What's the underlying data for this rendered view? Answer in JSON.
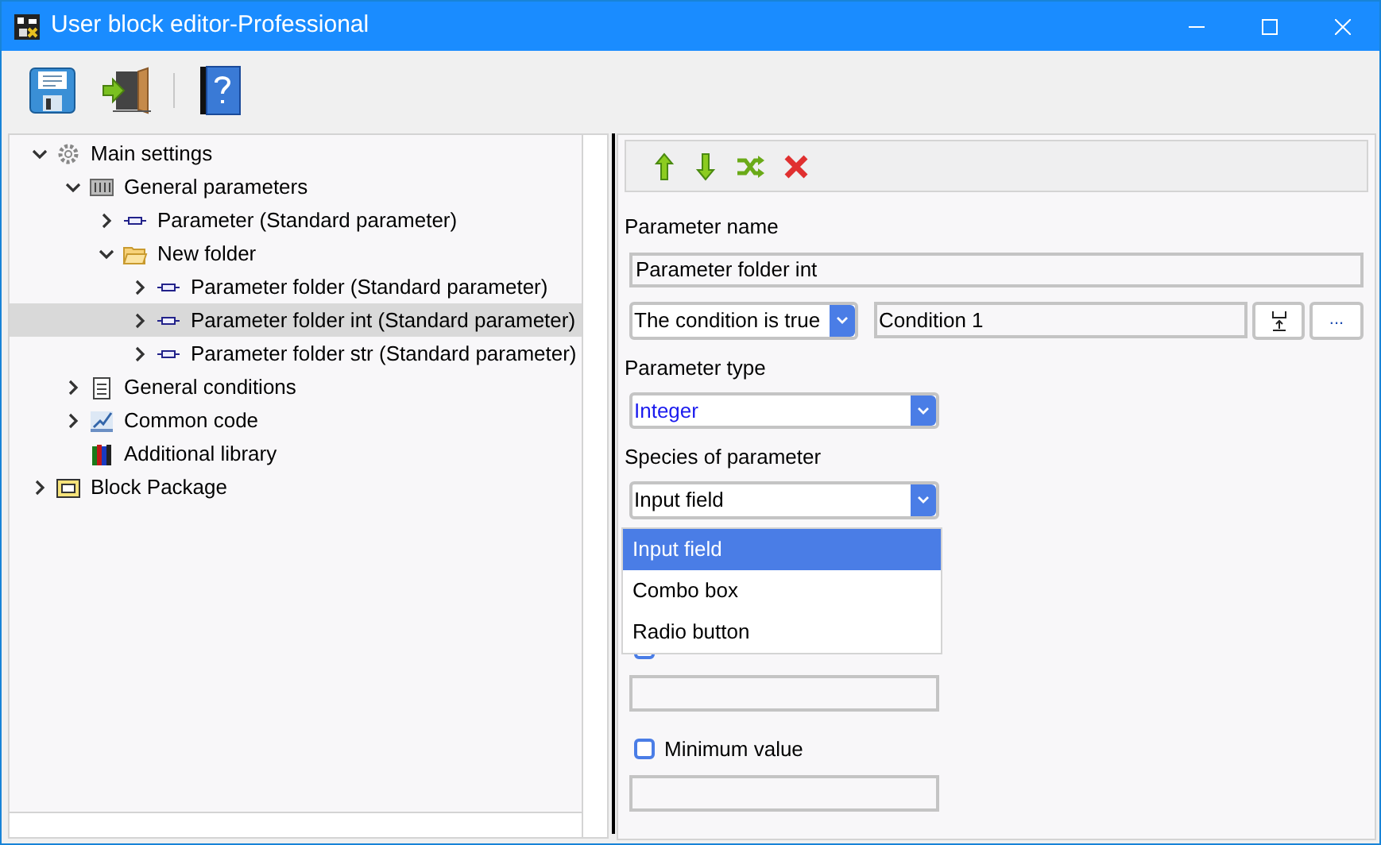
{
  "window": {
    "title": "User block editor-Professional"
  },
  "tree": [
    {
      "label": "Main settings",
      "kind": "settings",
      "expanded": true,
      "selected": false,
      "children": [
        {
          "label": "General parameters",
          "kind": "parameters",
          "expanded": true,
          "selected": false,
          "children": [
            {
              "label": "Parameter (Standard parameter)",
              "kind": "parameter",
              "expanded": false,
              "selected": false
            },
            {
              "label": "New folder",
              "kind": "folder",
              "expanded": true,
              "selected": false,
              "children": [
                {
                  "label": "Parameter folder (Standard parameter)",
                  "kind": "parameter",
                  "expanded": false,
                  "selected": false
                },
                {
                  "label": "Parameter folder int (Standard parameter)",
                  "kind": "parameter",
                  "expanded": false,
                  "selected": true
                },
                {
                  "label": "Parameter folder str (Standard parameter)",
                  "kind": "parameter",
                  "expanded": false,
                  "selected": false
                }
              ]
            }
          ]
        },
        {
          "label": "General conditions",
          "kind": "conditions",
          "expanded": false,
          "selected": false
        },
        {
          "label": "Common code",
          "kind": "code",
          "expanded": false,
          "selected": false
        },
        {
          "label": "Additional library",
          "kind": "library",
          "selected": false
        }
      ]
    },
    {
      "label": "Block Package",
      "kind": "package",
      "expanded": false,
      "selected": false
    }
  ],
  "editor": {
    "name_label": "Parameter name",
    "name_value": "Parameter folder int",
    "condition_select": "The condition is true",
    "condition_value": "Condition 1",
    "more_button": "...",
    "type_label": "Parameter type",
    "type_value": "Integer",
    "species_label": "Species of parameter",
    "species_value": "Input field",
    "species_options": [
      {
        "label": "Input field",
        "selected": true
      },
      {
        "label": "Combo box",
        "selected": false
      },
      {
        "label": "Radio button",
        "selected": false
      }
    ],
    "limits": [
      {
        "label": "Minimum value",
        "checked": false
      }
    ]
  }
}
